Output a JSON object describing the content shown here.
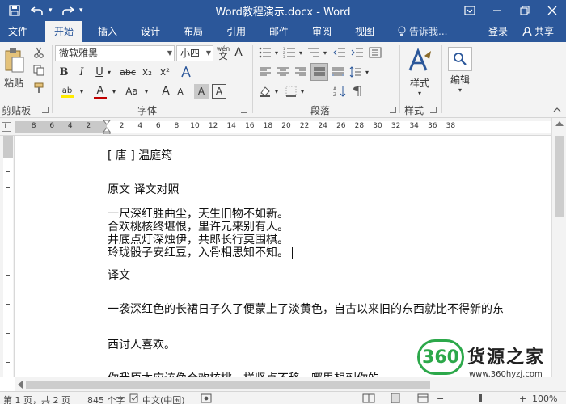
{
  "window": {
    "title": "Word教程演示.docx - Word",
    "accent": "#2b579a"
  },
  "qat": {
    "save_icon": "save-icon",
    "undo_icon": "undo-icon",
    "redo_icon": "redo-icon"
  },
  "tabs": [
    {
      "label": "文件"
    },
    {
      "label": "开始"
    },
    {
      "label": "插入"
    },
    {
      "label": "设计"
    },
    {
      "label": "布局"
    },
    {
      "label": "引用"
    },
    {
      "label": "邮件"
    },
    {
      "label": "审阅"
    },
    {
      "label": "视图"
    }
  ],
  "tellme": {
    "label": "告诉我..."
  },
  "account": {
    "login": "登录",
    "share": "共享"
  },
  "ribbon": {
    "clipboard": {
      "paste": "粘贴",
      "label": "剪贴板"
    },
    "font": {
      "name": "微软雅黑",
      "size": "小四",
      "label": "字体",
      "phonetic": "wén",
      "grow": "A",
      "shrink": "A",
      "case": "Aa",
      "clear": "A",
      "bold": "B",
      "italic": "I",
      "underline": "U",
      "strike": "abc",
      "sub": "x₂",
      "sup": "x²",
      "highlight": "ab",
      "color": "A",
      "char_shade": "A",
      "char_border": "A"
    },
    "paragraph": {
      "label": "段落"
    },
    "styles": {
      "btn": "样式",
      "label": "样式"
    },
    "editing": {
      "btn": "编辑"
    }
  },
  "ruler": {
    "box": "L",
    "left_nums": [
      "8",
      "6",
      "4",
      "2"
    ],
    "right_nums": [
      "2",
      "4",
      "6",
      "8",
      "10",
      "12",
      "14",
      "16",
      "18",
      "20",
      "22",
      "24",
      "26",
      "28",
      "30",
      "32",
      "34",
      "36",
      "38"
    ]
  },
  "document": {
    "lines": [
      "[ 唐 ] 温庭筠",
      "原文  译文对照",
      "一尺深红胜曲尘，天生旧物不如新。",
      "合欢桃核终堪恨，里许元来别有人。",
      "井底点灯深烛伊，共郎长行莫围棋。",
      "玲珑骰子安红豆，入骨相思知不知。",
      "译文",
      "一袭深红色的长裙日子久了便蒙上了淡黄色，自古以来旧的东西就比不得新的东",
      "西讨人喜欢。",
      "你我原本应该像合欢核桃一样坚贞不移，哪里想到你的"
    ]
  },
  "status": {
    "page": "第 1 页，共 2 页",
    "words": "845 个字",
    "lang": "中文(中国)",
    "zoom": "100%"
  },
  "watermark": {
    "num": "360",
    "name": "货源之家",
    "url": "www.360hyzj.com"
  }
}
